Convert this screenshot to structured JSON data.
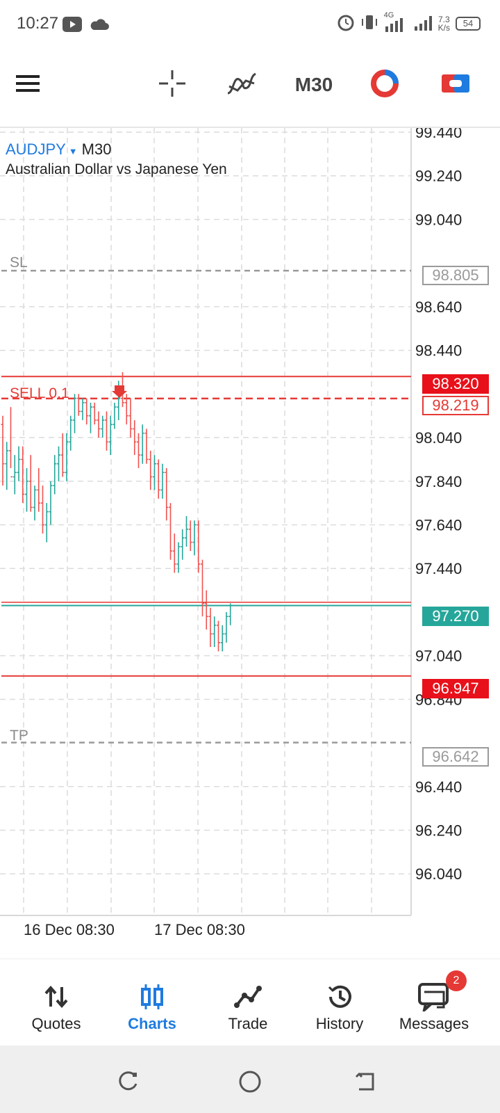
{
  "status_bar": {
    "time": "10:27",
    "network_speed_top": "7.3",
    "network_speed_bottom": "K/s",
    "network_type": "4G",
    "battery": "54"
  },
  "toolbar": {
    "timeframe": "M30",
    "icons": [
      "menu-icon",
      "crosshair-icon",
      "indicators-icon",
      "timeframe-button",
      "one-click-trading-icon",
      "trade-toggle-icon"
    ]
  },
  "chart": {
    "symbol": "AUDJPY",
    "timeframe": "M30",
    "description": "Australian Dollar vs Japanese Yen",
    "price_axis": [
      "99.440",
      "99.240",
      "99.040",
      "98.640",
      "98.440",
      "98.040",
      "97.840",
      "97.640",
      "97.440",
      "97.040",
      "96.840",
      "96.440",
      "96.240",
      "96.040"
    ],
    "time_axis": [
      "16 Dec 08:30",
      "17 Dec 08:30"
    ],
    "lines": {
      "sl_label": "SL",
      "sl_price": "98.805",
      "sell_label": "SELL 0.1",
      "sell_price": "98.219",
      "high_price": "98.320",
      "current_price": "97.270",
      "low_price": "96.947",
      "tp_label": "TP",
      "tp_price": "96.642"
    },
    "colors": {
      "bull": "#26a69a",
      "bear": "#ef5350",
      "accent": "#1e7be0",
      "red_line": "#e53935",
      "current": "#26a69a"
    }
  },
  "bottom_nav": {
    "items": [
      {
        "label": "Quotes",
        "icon": "arrows-up-down-icon"
      },
      {
        "label": "Charts",
        "icon": "candles-icon"
      },
      {
        "label": "Trade",
        "icon": "trend-line-icon"
      },
      {
        "label": "History",
        "icon": "history-clock-icon"
      },
      {
        "label": "Messages",
        "icon": "chat-bubbles-icon",
        "badge": "2"
      }
    ],
    "active": "Charts"
  }
}
